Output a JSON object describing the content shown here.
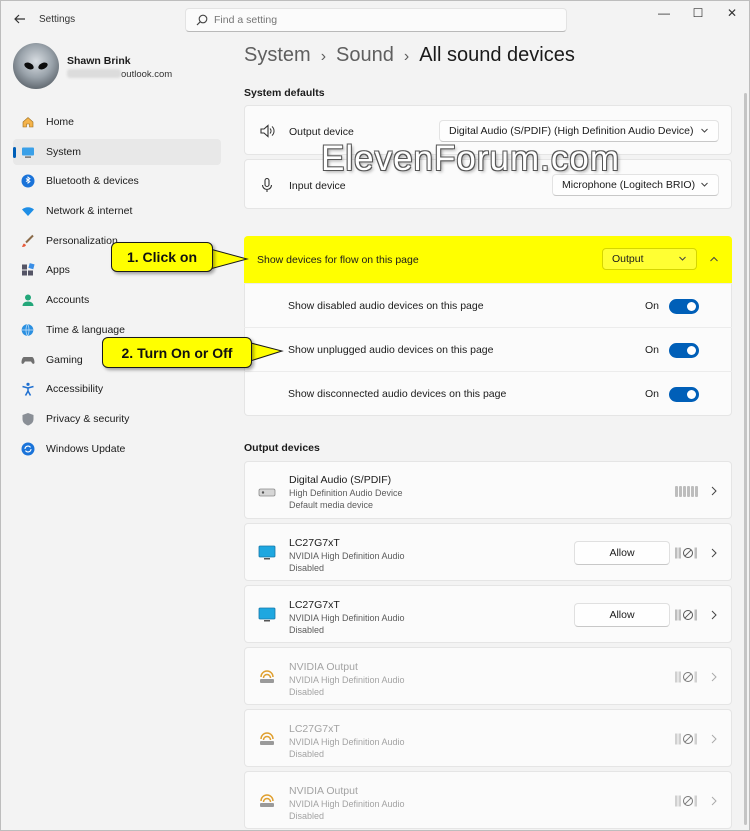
{
  "window": {
    "app_title": "Settings",
    "controls": {
      "minimize": "—",
      "maximize": "☐",
      "close": "✕"
    }
  },
  "search": {
    "placeholder": "Find a setting"
  },
  "profile": {
    "name": "Shawn Brink",
    "email_suffix": "outlook.com"
  },
  "sidebar": {
    "items": [
      {
        "label": "Home",
        "icon": "home-icon",
        "active": false
      },
      {
        "label": "System",
        "icon": "system-monitor-icon",
        "active": true
      },
      {
        "label": "Bluetooth & devices",
        "icon": "bluetooth-icon",
        "active": false
      },
      {
        "label": "Network & internet",
        "icon": "wifi-icon",
        "active": false
      },
      {
        "label": "Personalization",
        "icon": "brush-icon",
        "active": false
      },
      {
        "label": "Apps",
        "icon": "apps-icon",
        "active": false
      },
      {
        "label": "Accounts",
        "icon": "person-icon",
        "active": false
      },
      {
        "label": "Time & language",
        "icon": "globe-clock-icon",
        "active": false
      },
      {
        "label": "Gaming",
        "icon": "gamepad-icon",
        "active": false
      },
      {
        "label": "Accessibility",
        "icon": "accessibility-icon",
        "active": false
      },
      {
        "label": "Privacy & security",
        "icon": "shield-icon",
        "active": false
      },
      {
        "label": "Windows Update",
        "icon": "update-icon",
        "active": false
      }
    ]
  },
  "breadcrumb": {
    "level1": "System",
    "level2": "Sound",
    "current": "All sound devices",
    "separator": "›"
  },
  "system_defaults": {
    "title": "System defaults",
    "output": {
      "label": "Output device",
      "value": "Digital Audio (S/PDIF) (High Definition Audio Device)"
    },
    "input": {
      "label": "Input device",
      "value": "Microphone (Logitech BRIO)"
    }
  },
  "flow": {
    "label": "Show devices for flow on this page",
    "value": "Output",
    "toggles": [
      {
        "label": "Show disabled audio devices on this page",
        "state": "On"
      },
      {
        "label": "Show unplugged audio devices on this page",
        "state": "On"
      },
      {
        "label": "Show disconnected audio devices on this page",
        "state": "On"
      }
    ]
  },
  "output_devices": {
    "title": "Output devices",
    "allow_label": "Allow",
    "items": [
      {
        "name": "Digital Audio (S/PDIF)",
        "sub1": "High Definition Audio Device",
        "sub2": "Default media device",
        "icon": "spdif-speaker-icon",
        "has_allow": false,
        "dim": false
      },
      {
        "name": "LC27G7xT",
        "sub1": "NVIDIA High Definition Audio",
        "sub2": "Disabled",
        "icon": "monitor-icon",
        "has_allow": true,
        "dim": false
      },
      {
        "name": "LC27G7xT",
        "sub1": "NVIDIA High Definition Audio",
        "sub2": "Disabled",
        "icon": "monitor-icon",
        "has_allow": true,
        "dim": false
      },
      {
        "name": "NVIDIA Output",
        "sub1": "NVIDIA High Definition Audio",
        "sub2": "Disabled",
        "icon": "audio-jack-icon",
        "has_allow": false,
        "dim": true
      },
      {
        "name": "LC27G7xT",
        "sub1": "NVIDIA High Definition Audio",
        "sub2": "Disabled",
        "icon": "audio-jack-icon",
        "has_allow": false,
        "dim": true
      },
      {
        "name": "NVIDIA Output",
        "sub1": "NVIDIA High Definition Audio",
        "sub2": "Disabled",
        "icon": "audio-jack-icon",
        "has_allow": false,
        "dim": true
      }
    ]
  },
  "watermark": "ElevenForum.com",
  "callouts": {
    "step1": "1. Click on",
    "step2": "2. Turn On or Off"
  },
  "colors": {
    "accent": "#005fb8",
    "highlight": "#ffff00"
  }
}
